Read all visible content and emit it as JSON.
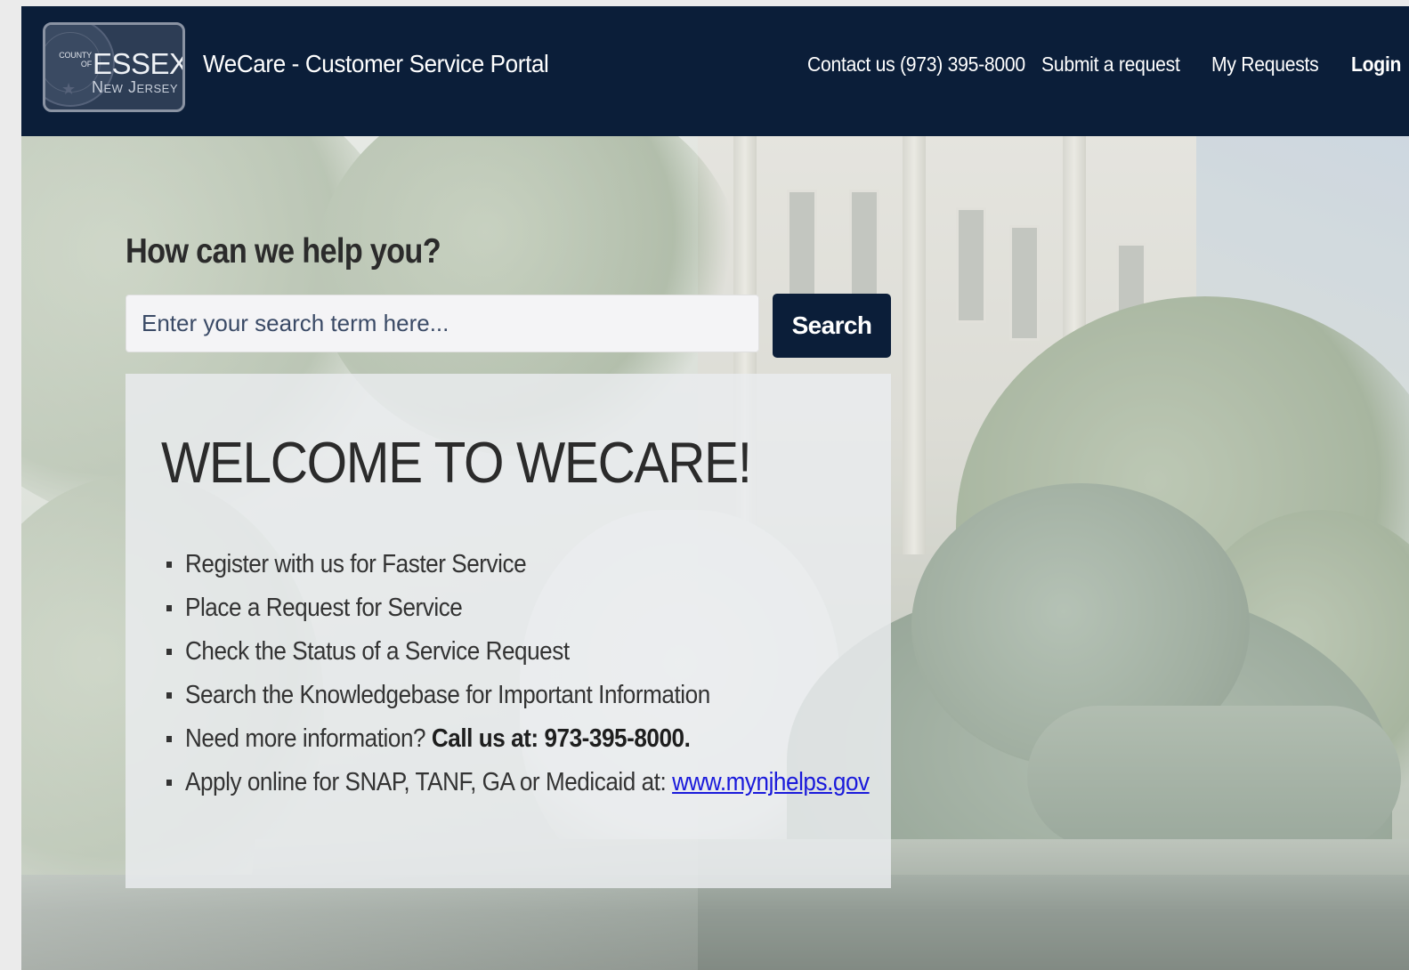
{
  "header": {
    "logo": {
      "county_of": "COUNTY OF",
      "name": "ESSEX",
      "state": "New Jersey"
    },
    "title": "WeCare - Customer Service Portal",
    "nav": [
      {
        "label": "Contact us (973) 395-8000"
      },
      {
        "label": "Submit a request"
      },
      {
        "label": "My Requests"
      },
      {
        "label": "Login"
      }
    ]
  },
  "search": {
    "heading": "How can we help you?",
    "placeholder": "Enter your search term here...",
    "value": "",
    "button_label": "Search"
  },
  "welcome": {
    "heading": "WELCOME TO WECARE!",
    "items": [
      {
        "text": "Register with us for Faster Service"
      },
      {
        "text": "Place a Request for Service"
      },
      {
        "text": "Check the Status of a Service Request"
      },
      {
        "text": "Search the Knowledgebase for Important Information"
      },
      {
        "prefix": "Need more information? ",
        "strong": "Call us at:  973-395-8000."
      },
      {
        "prefix": "Apply online for SNAP, TANF, GA or Medicaid at:  ",
        "link": "www.mynjhelps.gov"
      }
    ]
  },
  "colors": {
    "navbar_bg": "#0b1e39",
    "button_bg": "#0b1e39",
    "link": "#1a1adb",
    "heading_text": "#2b2b2b"
  },
  "icons": [
    "county-seal-icon"
  ]
}
